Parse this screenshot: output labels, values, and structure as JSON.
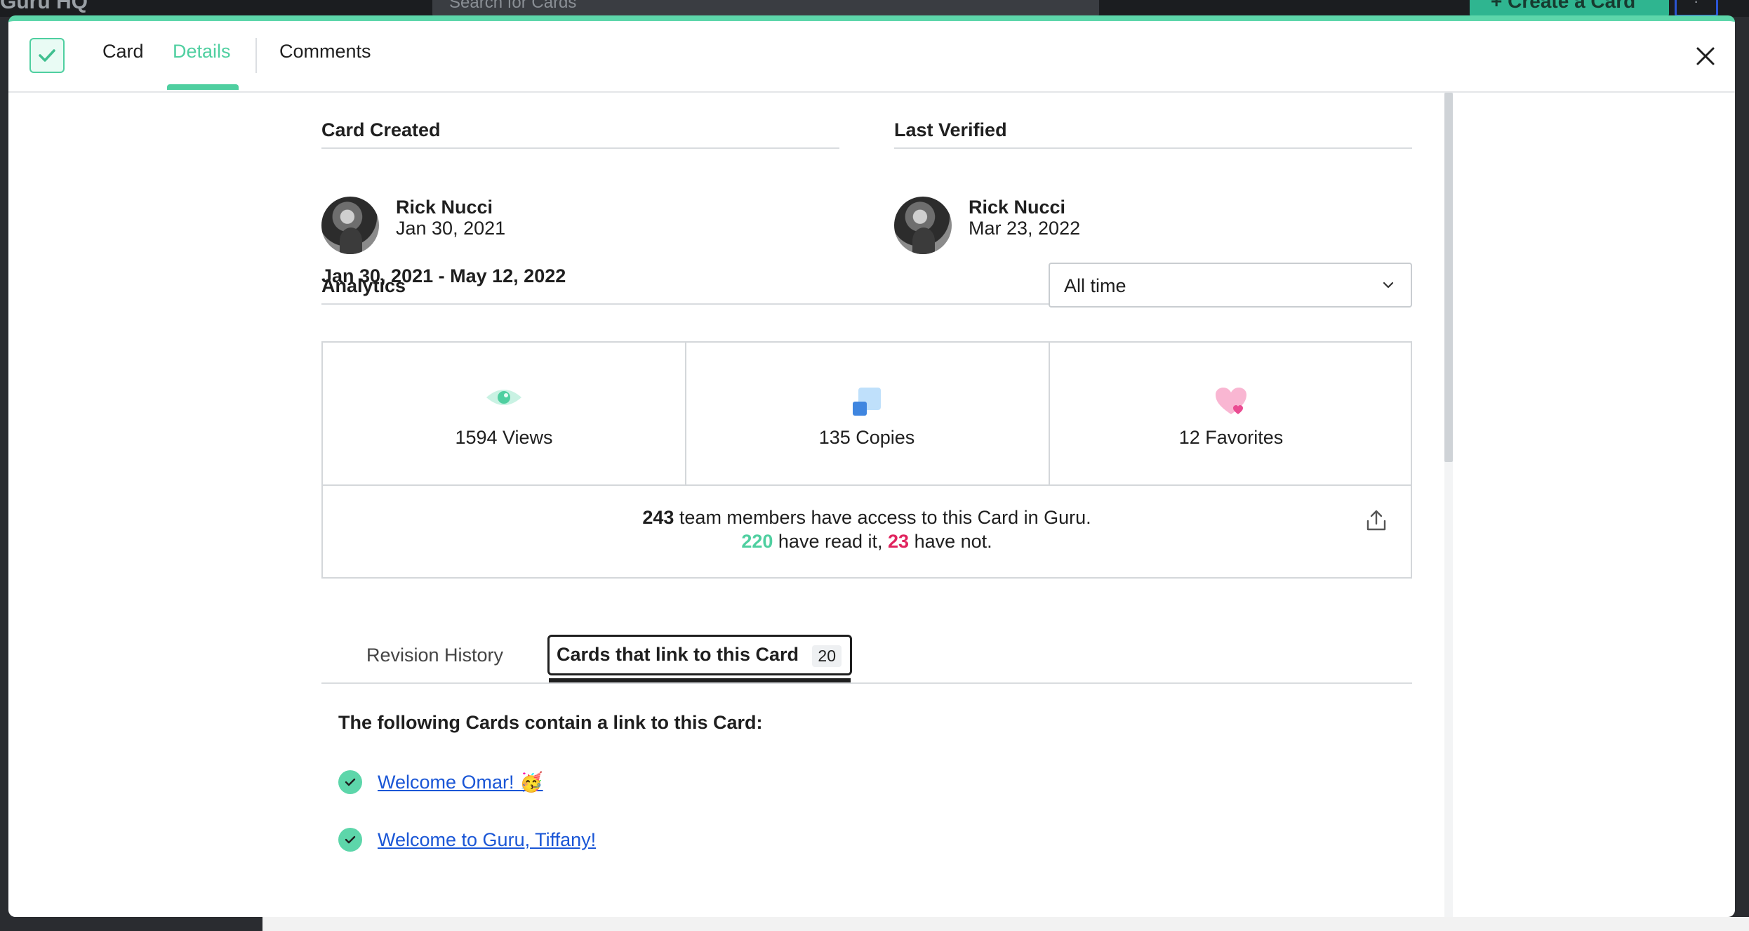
{
  "background": {
    "title": "Guru HQ",
    "search_placeholder": "Search for Cards",
    "create_button": "+ Create a Card",
    "help_label": "?"
  },
  "header": {
    "tabs": {
      "card": "Card",
      "details": "Details",
      "comments": "Comments"
    },
    "active_tab": "Details",
    "accent_color": "#4fcfa0"
  },
  "card_created": {
    "title": "Card Created",
    "name": "Rick Nucci",
    "date": "Jan 30, 2021"
  },
  "last_verified": {
    "title": "Last Verified",
    "name": "Rick Nucci",
    "date": "Mar 23, 2022"
  },
  "analytics": {
    "title": "Analytics",
    "date_range": "Jan 30, 2021 - May 12, 2022",
    "period_select": {
      "value": "All time"
    },
    "stats": {
      "views": "1594 Views",
      "copies": "135 Copies",
      "favorites": "12 Favorites"
    },
    "access": {
      "total": "243",
      "total_suffix": " team members have access to this Card in Guru.",
      "read": "220",
      "read_suffix": " have read it, ",
      "not_read": "23",
      "not_read_suffix": " have not."
    }
  },
  "subtabs": {
    "revision_history": "Revision History",
    "linked_cards": "Cards that link to this Card",
    "linked_count": "20"
  },
  "linked_cards": {
    "intro": "The following Cards contain a link to this Card:",
    "items": [
      {
        "title": "Welcome Omar! 🥳"
      },
      {
        "title": "Welcome to Guru, Tiffany!"
      }
    ]
  }
}
